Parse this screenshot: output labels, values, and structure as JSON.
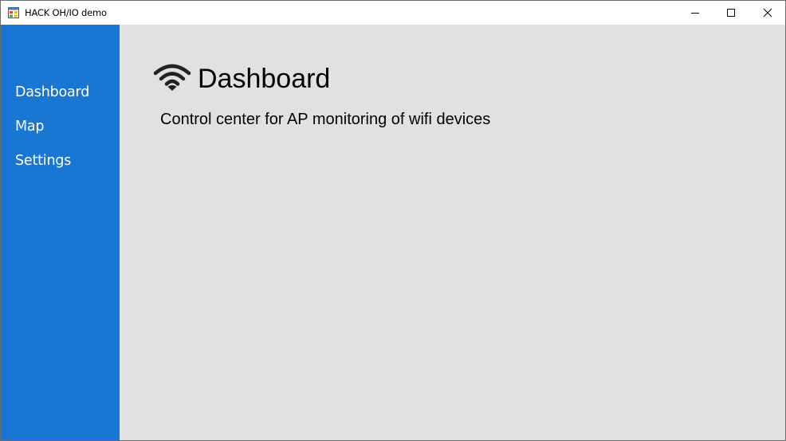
{
  "window": {
    "title": "HACK OH/IO demo",
    "icon": "app-form-icon",
    "controls": {
      "minimize": "minimize-icon",
      "maximize": "maximize-icon",
      "close": "close-icon"
    }
  },
  "sidebar": {
    "background": "#1976d2",
    "items": [
      {
        "label": "Dashboard"
      },
      {
        "label": "Map"
      },
      {
        "label": "Settings"
      }
    ]
  },
  "main": {
    "background": "#e1e1e1",
    "icon": "wifi-icon",
    "title": "Dashboard",
    "subtitle": "Control center for AP monitoring of wifi devices"
  }
}
